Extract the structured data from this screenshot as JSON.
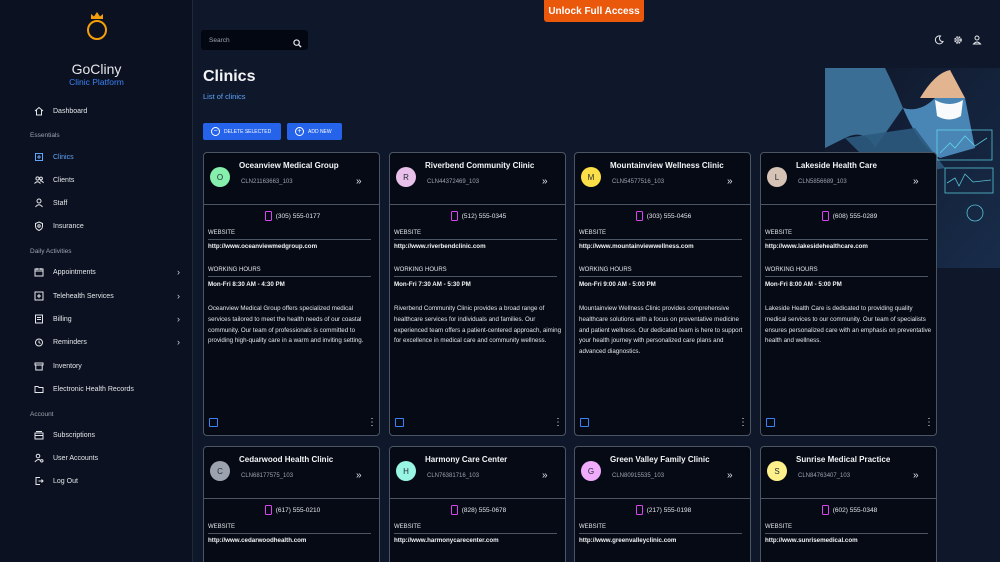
{
  "banner": {
    "unlock_label": "Unlock Full Access"
  },
  "brand": {
    "name": "GoCliny",
    "subtitle": "Clinic Platform"
  },
  "sidebar": {
    "dashboard": "Dashboard",
    "sections": {
      "essentials": "Essentials",
      "daily": "Daily Activities",
      "account": "Account"
    },
    "essentials": [
      "Clinics",
      "Clients",
      "Staff",
      "Insurance"
    ],
    "daily": [
      "Appointments",
      "Telehealth Services",
      "Billing",
      "Reminders",
      "Inventory",
      "Electronic Health Records"
    ],
    "account": [
      "Subscriptions",
      "User Accounts",
      "Log Out"
    ]
  },
  "search": {
    "placeholder": "Search"
  },
  "page": {
    "title": "Clinics",
    "subtitle": "List of clinics"
  },
  "toolbar": {
    "delete_label": "DELETE SELECTED",
    "add_label": "ADD NEW"
  },
  "labels": {
    "website": "WEBSITE",
    "hours": "WORKING HOURS"
  },
  "accent": {
    "primary": "#2563eb",
    "cta": "#ea580c",
    "phone_icon": "#d946ef"
  },
  "clinics": [
    {
      "initial": "O",
      "avatar_color": "#86efac",
      "name": "Oceanview Medical Group",
      "id": "CLN21163663_103",
      "phone": "(305) 555-0177",
      "website": "http://www.oceanviewmedgroup.com",
      "hours": "Mon-Fri 8:30 AM - 4:30 PM",
      "description": "Oceanview Medical Group offers specialized medical services tailored to meet the health needs of our coastal community. Our team of professionals is committed to providing high-quality care in a warm and inviting setting."
    },
    {
      "initial": "R",
      "avatar_color": "#e9c0e9",
      "name": "Riverbend Community Clinic",
      "id": "CLN44372469_103",
      "phone": "(512) 555-0345",
      "website": "http://www.riverbendclinic.com",
      "hours": "Mon-Fri 7:30 AM - 5:30 PM",
      "description": "Riverbend Community Clinic provides a broad range of healthcare services for individuals and families. Our experienced team offers a patient-centered approach, aiming for excellence in medical care and community wellness."
    },
    {
      "initial": "M",
      "avatar_color": "#fde047",
      "name": "Mountainview Wellness Clinic",
      "id": "CLN54577516_103",
      "phone": "(303) 555-0456",
      "website": "http://www.mountainviewwellness.com",
      "hours": "Mon-Fri 9:00 AM - 5:00 PM",
      "description": "Mountainview Wellness Clinic provides comprehensive healthcare solutions with a focus on preventative medicine and patient wellness. Our dedicated team is here to support your health journey with personalized care plans and advanced diagnostics."
    },
    {
      "initial": "L",
      "avatar_color": "#d6c3b5",
      "name": "Lakeside Health Care",
      "id": "CLN5856689_103",
      "phone": "(608) 555-0289",
      "website": "http://www.lakesidehealthcare.com",
      "hours": "Mon-Fri 8:00 AM - 5:00 PM",
      "description": "Lakeside Health Care is dedicated to providing quality medical services to our community. Our team of specialists ensures personalized care with an emphasis on preventative health and wellness."
    },
    {
      "initial": "C",
      "avatar_color": "#9ca3af",
      "name": "Cedarwood Health Clinic",
      "id": "CLN68177575_103",
      "phone": "(617) 555-0210",
      "website": "http://www.cedarwoodhealth.com",
      "hours": "",
      "description": ""
    },
    {
      "initial": "H",
      "avatar_color": "#99f6e4",
      "name": "Harmony Care Center",
      "id": "CLN76381716_103",
      "phone": "(828) 555-0678",
      "website": "http://www.harmonycarecenter.com",
      "hours": "",
      "description": ""
    },
    {
      "initial": "G",
      "avatar_color": "#f0abfc",
      "name": "Green Valley Family Clinic",
      "id": "CLN80915535_103",
      "phone": "(217) 555-0198",
      "website": "http://www.greenvalleyclinic.com",
      "hours": "",
      "description": ""
    },
    {
      "initial": "S",
      "avatar_color": "#fef08a",
      "name": "Sunrise Medical Practice",
      "id": "CLN84763407_103",
      "phone": "(602) 555-0348",
      "website": "http://www.sunrisemedical.com",
      "hours": "",
      "description": ""
    }
  ]
}
